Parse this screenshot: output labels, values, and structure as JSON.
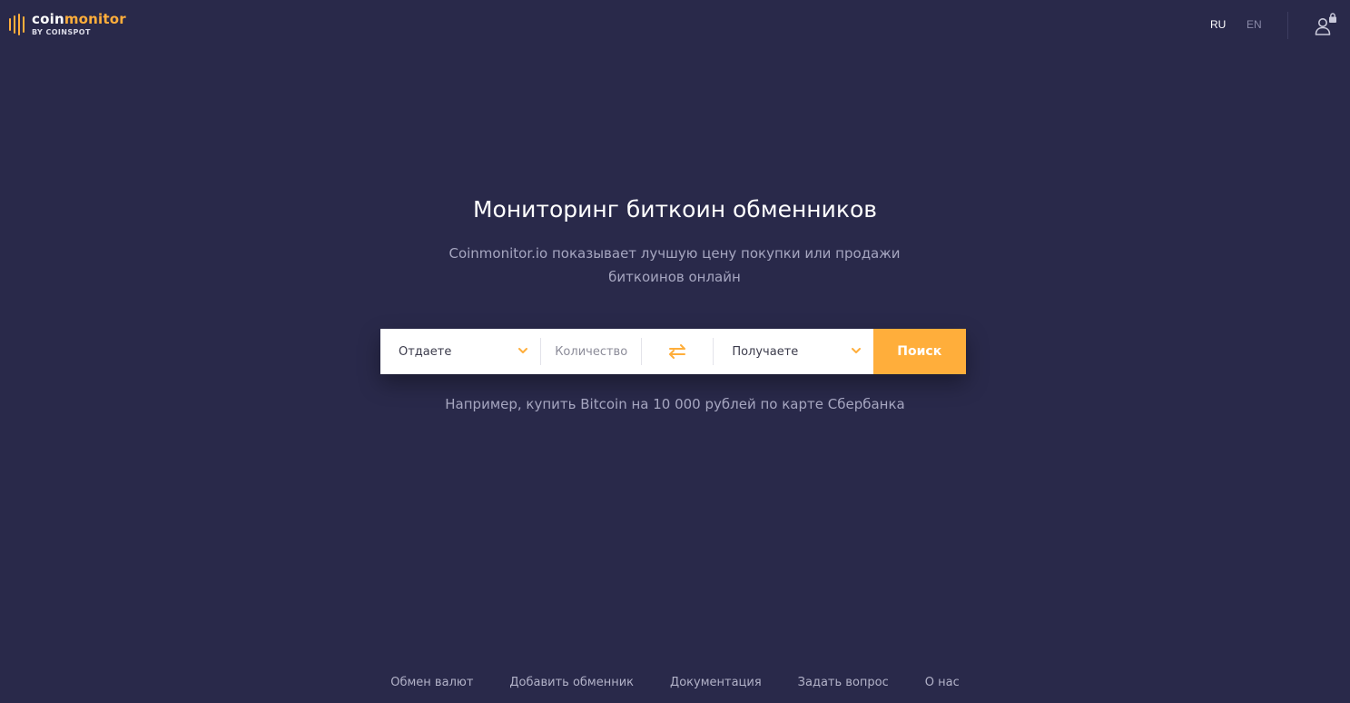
{
  "header": {
    "logo": {
      "name_part1": "coin",
      "name_part2": "monitor",
      "sub": "BY COINSPOT"
    },
    "languages": [
      {
        "label": "RU",
        "active": true
      },
      {
        "label": "EN",
        "active": false
      }
    ],
    "user_icon": "user-lock-icon"
  },
  "hero": {
    "title": "Мониторинг биткоин обменников",
    "subtitle": "Coinmonitor.io показывает лучшую цену покупки или продажи биткоинов онлайн"
  },
  "search": {
    "give_label": "Отдаете",
    "amount_placeholder": "Количество",
    "swap_icon": "swap-arrows-icon",
    "get_label": "Получаете",
    "search_button": "Поиск"
  },
  "example_text": "Например, купить Bitcoin на 10 000 рублей по карте Сбербанка",
  "footer": {
    "links": [
      "Обмен валют",
      "Добавить обменник",
      "Документация",
      "Задать вопрос",
      "О нас"
    ]
  },
  "colors": {
    "background": "#29294a",
    "accent": "#ffae3b",
    "muted_text": "#a6a6c0"
  }
}
